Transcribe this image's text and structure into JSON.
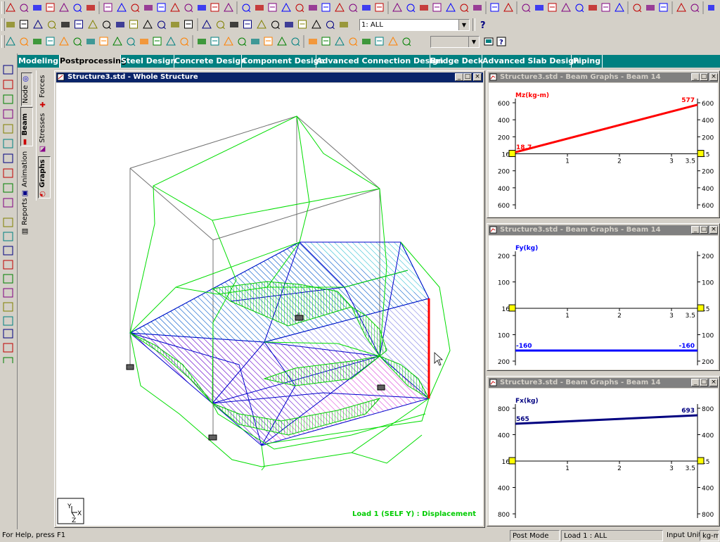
{
  "toolbar": {
    "load_case_value": "1: ALL",
    "group_value": ""
  },
  "tabs": [
    {
      "label": "Modeling",
      "active": false
    },
    {
      "label": "Postprocessing",
      "active": true
    },
    {
      "label": "Steel Design",
      "active": false
    },
    {
      "label": "Concrete Design",
      "active": false
    },
    {
      "label": "Component Design",
      "active": false
    },
    {
      "label": "Advanced Connection Design",
      "active": false
    },
    {
      "label": "Bridge Deck",
      "active": false
    },
    {
      "label": "Advanced Slab Design",
      "active": false
    },
    {
      "label": "Piping",
      "active": false
    }
  ],
  "side_tabs": {
    "outer": [
      "Node",
      "Beam",
      "Animation",
      "Reports"
    ],
    "inner": [
      "Forces",
      "Stresses",
      "Graphs"
    ]
  },
  "main_window": {
    "title": "Structure3.std - Whole Structure",
    "load_label": "Load 1 (SELF Y) : Displacement",
    "axis_labels": {
      "y": "Y",
      "x": "X",
      "z": "Z"
    }
  },
  "graphs": [
    {
      "title": "Structure3.std - Beam Graphs - Beam 14",
      "quantity": "Mz(kg-m)",
      "color": "#ff0000",
      "left_ticks": [
        "600",
        "400",
        "200",
        "16",
        "200",
        "400",
        "600"
      ],
      "right_ticks": [
        "600",
        "400",
        "200",
        "15",
        "200",
        "400",
        "600"
      ],
      "x_ticks": [
        "1",
        "2",
        "3",
        "3.5"
      ],
      "start_label": "18.7",
      "end_label": "577",
      "start_value": 18.7,
      "end_value": 577,
      "range": 600
    },
    {
      "title": "Structure3.std - Beam Graphs - Beam 14",
      "quantity": "Fy(kg)",
      "color": "#0000ff",
      "left_ticks": [
        "200",
        "100",
        "16",
        "100",
        "200"
      ],
      "right_ticks": [
        "200",
        "100",
        "15",
        "100",
        "200"
      ],
      "x_ticks": [
        "1",
        "2",
        "3",
        "3.5"
      ],
      "start_label": "-160",
      "end_label": "-160",
      "start_value": -160,
      "end_value": -160,
      "range": 200
    },
    {
      "title": "Structure3.std - Beam Graphs - Beam 14",
      "quantity": "Fx(kg)",
      "color": "#000080",
      "left_ticks": [
        "800",
        "400",
        "16",
        "400",
        "800"
      ],
      "right_ticks": [
        "800",
        "400",
        "15",
        "400",
        "800"
      ],
      "x_ticks": [
        "1",
        "2",
        "3",
        "3.5"
      ],
      "start_label": "565",
      "end_label": "693",
      "start_value": 565,
      "end_value": 693,
      "range": 800
    }
  ],
  "status": {
    "help": "For Help, press F1",
    "mode": "Post Mode",
    "load": "Load 1 : ALL",
    "units_label": "Input Units:",
    "units_value": "kg-m"
  },
  "colors": {
    "tab_bar": "#008080",
    "title_active": "#0a246a",
    "title_inactive": "#808080",
    "structure_green": "#00dd00",
    "slab_blue": "#0000cc",
    "slab_cyan": "#00c8c8",
    "slab_magenta": "#ff00ff",
    "beam_red": "#ff0000"
  }
}
